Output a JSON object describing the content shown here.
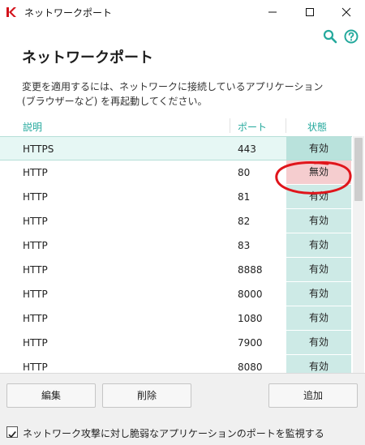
{
  "window": {
    "title": "ネットワークポート",
    "buttons": [
      "minimize",
      "maximize",
      "close"
    ]
  },
  "header": {
    "icons": [
      "search-icon",
      "help-icon"
    ],
    "page_title": "ネットワークポート",
    "info_text": "変更を適用するには、ネットワークに接続しているアプリケーション (ブラウザーなど) を再起動してください。"
  },
  "table": {
    "columns": [
      "説明",
      "ポート",
      "状態"
    ],
    "rows": [
      {
        "desc": "HTTPS",
        "port": "443",
        "state": "有効",
        "selected": true
      },
      {
        "desc": "HTTP",
        "port": "80",
        "state": "無効"
      },
      {
        "desc": "HTTP",
        "port": "81",
        "state": "有効"
      },
      {
        "desc": "HTTP",
        "port": "82",
        "state": "有効"
      },
      {
        "desc": "HTTP",
        "port": "83",
        "state": "有効"
      },
      {
        "desc": "HTTP",
        "port": "8888",
        "state": "有効"
      },
      {
        "desc": "HTTP",
        "port": "8000",
        "state": "有効"
      },
      {
        "desc": "HTTP",
        "port": "1080",
        "state": "有効"
      },
      {
        "desc": "HTTP",
        "port": "7900",
        "state": "有効"
      },
      {
        "desc": "HTTP",
        "port": "8080",
        "state": "有効"
      }
    ]
  },
  "footer": {
    "edit_label": "編集",
    "delete_label": "削除",
    "add_label": "追加",
    "monitor_checkbox_label": "ネットワーク攻撃に対し脆弱なアプリケーションのポートを監視する",
    "monitor_checked": true
  },
  "colors": {
    "accent": "#25a99d",
    "enabled_cell": "#cdeae6",
    "disabled_cell": "#f5cdcf",
    "annotation": "#e0151b"
  }
}
